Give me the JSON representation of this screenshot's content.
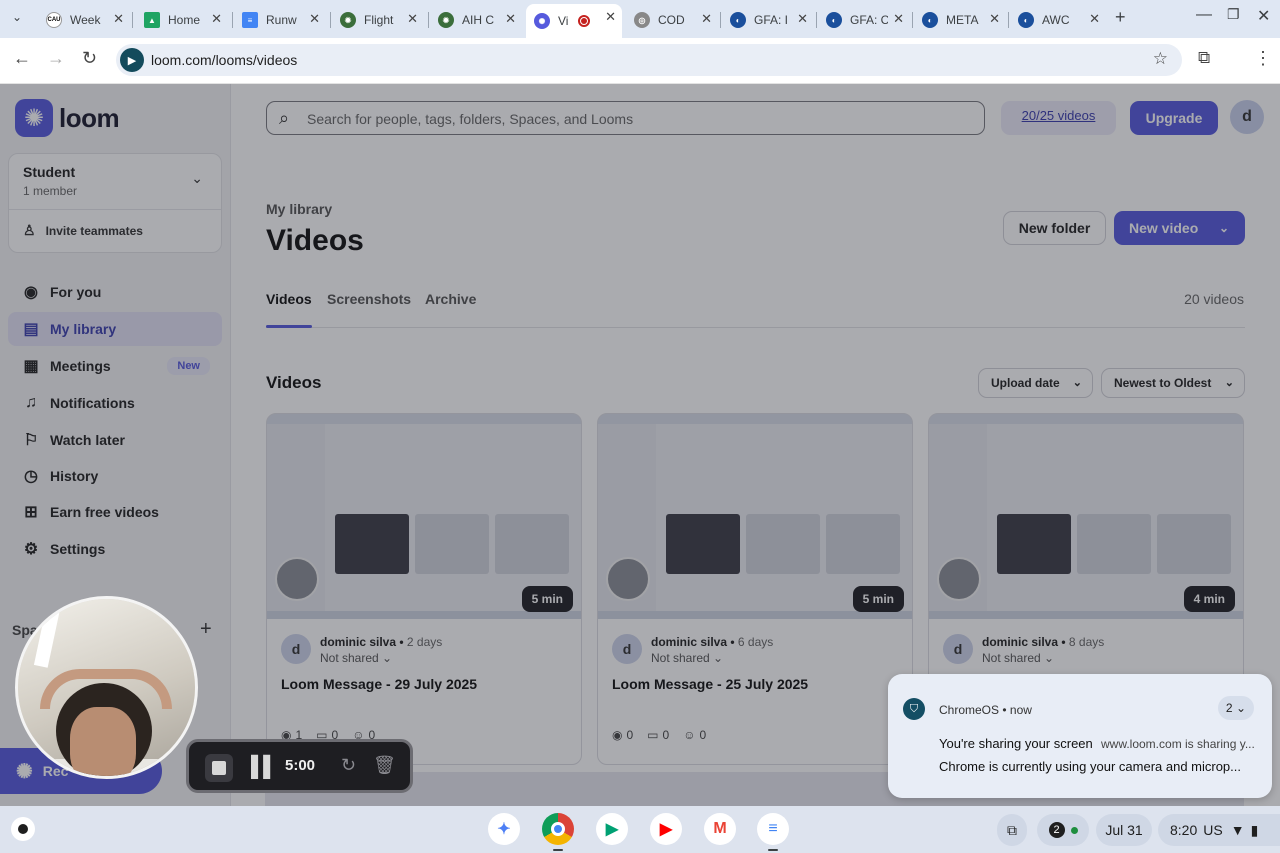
{
  "browser": {
    "tabs": [
      {
        "title": "Week",
        "icon": "cau-icon",
        "color": "#1a1a1a",
        "active": false
      },
      {
        "title": "Home",
        "icon": "google-drive-icon",
        "color": "#1fa463",
        "active": false
      },
      {
        "title": "Runw",
        "icon": "google-docs-icon",
        "color": "#4285f4",
        "active": false
      },
      {
        "title": "Flight",
        "icon": "seal-icon",
        "color": "#3b6e3b",
        "active": false
      },
      {
        "title": "AIH C",
        "icon": "seal-icon",
        "color": "#3b6e3b",
        "active": false
      },
      {
        "title": "Vi",
        "icon": "loom-icon",
        "color": "#565add",
        "active": true,
        "recording": true
      },
      {
        "title": "COD",
        "icon": "globe-icon",
        "color": "#888888",
        "active": false
      },
      {
        "title": "GFA: I",
        "icon": "noaa-icon",
        "color": "#1a4f9c",
        "active": false
      },
      {
        "title": "GFA: C",
        "icon": "noaa-icon",
        "color": "#1a4f9c",
        "active": false
      },
      {
        "title": "META",
        "icon": "noaa-icon",
        "color": "#1a4f9c",
        "active": false
      },
      {
        "title": "AWC",
        "icon": "noaa-icon",
        "color": "#1a4f9c",
        "active": false
      }
    ],
    "url": "loom.com/looms/videos"
  },
  "sidebar": {
    "brand": "loom",
    "workspace": {
      "name": "Student",
      "members": "1 member",
      "invite": "Invite teammates"
    },
    "nav": [
      {
        "label": "For you",
        "icon": "user-circle-icon",
        "active": false
      },
      {
        "label": "My library",
        "icon": "library-icon",
        "active": true
      },
      {
        "label": "Meetings",
        "icon": "calendar-icon",
        "active": false,
        "badge": "New"
      },
      {
        "label": "Notifications",
        "icon": "bell-icon",
        "active": false
      },
      {
        "label": "Watch later",
        "icon": "bookmark-icon",
        "active": false
      },
      {
        "label": "History",
        "icon": "clock-icon",
        "active": false
      },
      {
        "label": "Earn free videos",
        "icon": "gift-icon",
        "active": false
      },
      {
        "label": "Settings",
        "icon": "gear-icon",
        "active": false
      }
    ],
    "spaces_label": "Spa",
    "record_label": "Rec"
  },
  "header": {
    "search_placeholder": "Search for people, tags, folders, Spaces, and Looms",
    "quota": "20/25 videos",
    "upgrade": "Upgrade",
    "avatar_initial": "d"
  },
  "main": {
    "breadcrumb": "My library",
    "title": "Videos",
    "new_folder": "New folder",
    "new_video": "New video",
    "tabs": [
      "Videos",
      "Screenshots",
      "Archive"
    ],
    "count": "20 videos",
    "section_title": "Videos",
    "sort_field": "Upload date",
    "sort_order": "Newest to Oldest",
    "videos": [
      {
        "author": "dominic silva",
        "time": "2 days",
        "sharing": "Not shared",
        "title": "Loom Message - 29 July 2025",
        "duration": "5 min",
        "views": "1",
        "comments": "0",
        "reactions": "0"
      },
      {
        "author": "dominic silva",
        "time": "6 days",
        "sharing": "Not shared",
        "title": "Loom Message - 25 July 2025",
        "duration": "5 min",
        "views": "0",
        "comments": "0",
        "reactions": "0"
      },
      {
        "author": "dominic silva",
        "time": "8 days",
        "sharing": "Not shared",
        "title": "",
        "duration": "4 min",
        "views": "",
        "comments": "",
        "reactions": ""
      }
    ]
  },
  "recorder": {
    "time": "5:00"
  },
  "notification": {
    "app": "ChromeOS",
    "when": "now",
    "count": "2",
    "title": "You're sharing your screen",
    "sub": "www.loom.com is sharing y...",
    "body": "Chrome is currently using your camera and microp..."
  },
  "shelf": {
    "apps": [
      "gemini-icon",
      "chrome-icon",
      "play-store-icon",
      "youtube-icon",
      "gmail-icon",
      "google-docs-icon"
    ],
    "notification_count": "2",
    "date": "Jul 31",
    "time": "8:20",
    "locale": "US"
  },
  "colors": {
    "accent": "#565add",
    "accent_dark": "#3c3fae"
  }
}
